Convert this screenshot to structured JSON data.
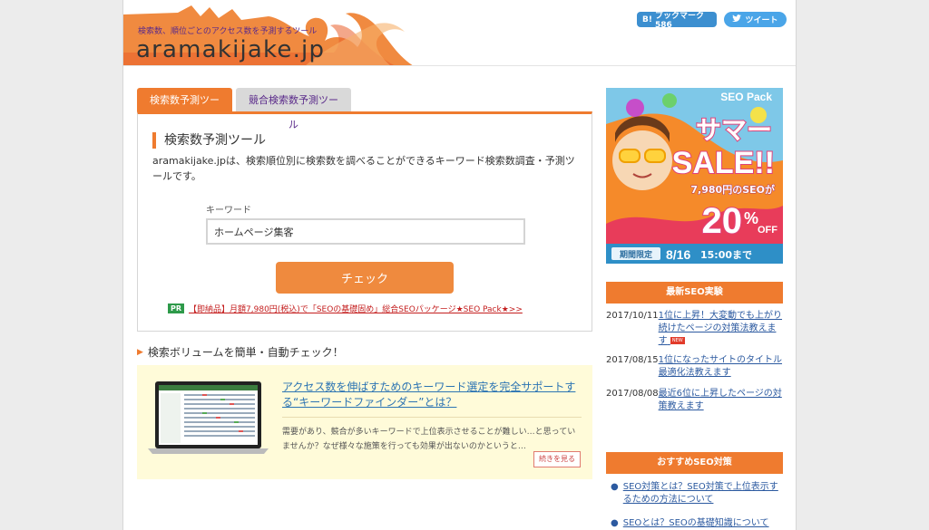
{
  "header": {
    "tagline": "検索数、順位ごとのアクセス数を予測するツール",
    "logo": "aramakijake.jp",
    "hatena_label": "ブックマーク 586",
    "hatena_icon": "B!",
    "tweet_label": "ツイート"
  },
  "tabs": [
    {
      "label": "検索数予測ツール",
      "active": true
    },
    {
      "label": "競合検索数予測ツール",
      "active": false
    }
  ],
  "tool": {
    "title": "検索数予測ツール",
    "description": "aramakijake.jpは、検索順位別に検索数を調べることができるキーワード検索数調査・予測ツールです。",
    "keyword_label": "キーワード",
    "keyword_value": "ホームページ集客",
    "check_label": "チェック",
    "pr_badge": "PR",
    "pr_text": "【即納品】月額7,980円(税込)で「SEOの基礎固め」総合SEOパッケージ★SEO Pack★>>"
  },
  "section": {
    "heading": "検索ボリュームを簡単・自動チェック！"
  },
  "promo": {
    "title": "アクセス数を伸ばすためのキーワード選定を完全サポートする“キーワードファインダー”とは？",
    "description": "需要があり、競合が多いキーワードで上位表示させることが難しい…と思っていませんか？なぜ様々な施策を行っても効果が出ないのかというと…",
    "more_label": "続きを見る"
  },
  "ad": {
    "brand": "SEO Pack",
    "headline1": "サマー",
    "headline2": "SALE!!",
    "sub": "7,980円のSEOが",
    "discount": "20",
    "percent": "%",
    "off": "OFF",
    "limited": "期間限定",
    "date": "8/16",
    "time": "15:00まで"
  },
  "sidebar": {
    "news_heading": "最新SEO実験",
    "news": [
      {
        "date": "2017/10/11",
        "title": "1位に上昇！大変動でも上がり続けたページの対策法教えます",
        "new": "NEW"
      },
      {
        "date": "2017/08/15",
        "title": "1位になったサイトのタイトル最適化法教えます"
      },
      {
        "date": "2017/08/08",
        "title": "最近6位に上昇したページの対策教えます"
      }
    ],
    "rec_heading": "おすすめSEO対策",
    "recommended": [
      {
        "title": "SEO対策とは？SEO対策で上位表示するための方法について"
      },
      {
        "title": "SEOとは？SEOの基礎知識について"
      }
    ]
  },
  "colors": {
    "accent": "#ef7b2f",
    "link": "#2c5aa0",
    "tab_inactive_text": "#5a2a8a",
    "pr_green": "#2e9a4a"
  }
}
